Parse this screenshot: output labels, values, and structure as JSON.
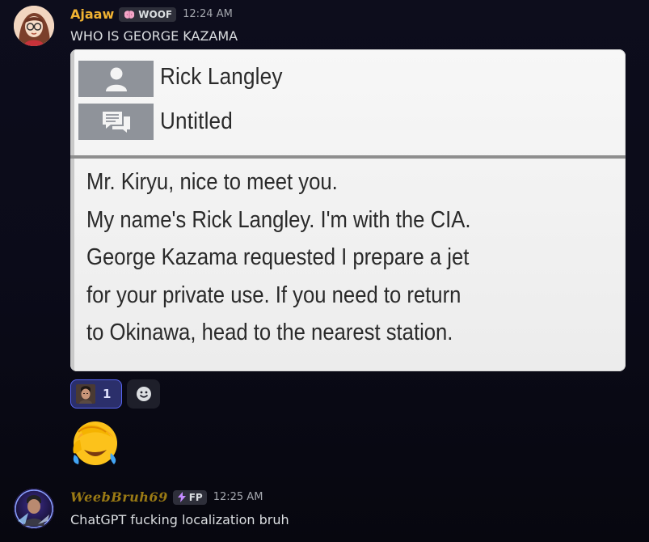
{
  "messages": [
    {
      "author": "Ajaaw",
      "author_color": "#f0b232",
      "tag_icon": "brain-icon",
      "tag_label": "WOOF",
      "time": "12:24 AM",
      "text": "WHO IS GEORGE KAZAMA",
      "attachment": {
        "speaker_name": "Rick Langley",
        "location": "Untitled",
        "dialogue": [
          "Mr. Kiryu, nice to meet you.",
          "My name's Rick Langley. I'm with the CIA.",
          "George Kazama requested I prepare a jet",
          "for your private use. If you need to return",
          "to Okinawa, head to the nearest station."
        ]
      },
      "reactions": [
        {
          "emoji": "custom-face-emoji",
          "count": "1",
          "reacted": true
        }
      ],
      "add_reaction_icon": "smiley-add-icon",
      "emoji_only": "face-holding-back-tears-laughing"
    },
    {
      "author": "WeebBruh69",
      "author_color": "#9a7a14",
      "tag_icon": "lightning-icon",
      "tag_label": "FP",
      "time": "12:25 AM",
      "text": "ChatGPT fucking localization bruh"
    }
  ]
}
